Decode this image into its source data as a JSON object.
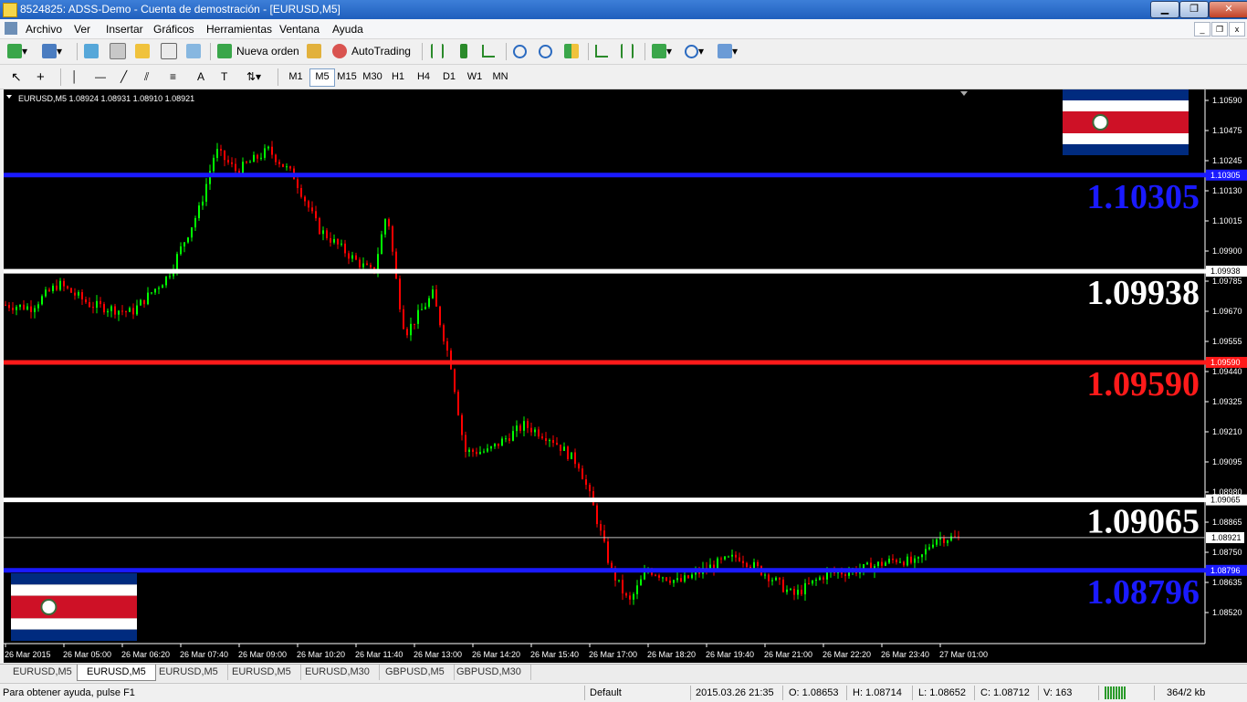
{
  "window": {
    "title": "8524825: ADSS-Demo - Cuenta de demostración - [EURUSD,M5]",
    "minimize": "▁",
    "restore": "❐",
    "close": "✕"
  },
  "menu": [
    "Archivo",
    "Ver",
    "Insertar",
    "Gráficos",
    "Herramientas",
    "Ventana",
    "Ayuda"
  ],
  "toolbar": {
    "new_order": "Nueva orden",
    "autotrading": "AutoTrading",
    "search_placeholder": ""
  },
  "timeframes": [
    "M1",
    "M5",
    "M15",
    "M30",
    "H1",
    "H4",
    "D1",
    "W1",
    "MN"
  ],
  "active_timeframe": "M5",
  "chart": {
    "header": "EURUSD,M5  1.08924 1.08931 1.08910 1.08921",
    "price_labels": [
      "1.10590",
      "1.10475",
      "1.10245",
      "1.10130",
      "1.10015",
      "1.09900",
      "1.09785",
      "1.09670",
      "1.09555",
      "1.09440",
      "1.09325",
      "1.09210",
      "1.09095",
      "1.08980",
      "1.08865",
      "1.08750",
      "1.08635",
      "1.08520"
    ],
    "time_labels": [
      "26 Mar 2015",
      "26 Mar 05:00",
      "26 Mar 06:20",
      "26 Mar 07:40",
      "26 Mar 09:00",
      "26 Mar 10:20",
      "26 Mar 11:40",
      "26 Mar 13:00",
      "26 Mar 14:20",
      "26 Mar 15:40",
      "26 Mar 17:00",
      "26 Mar 18:20",
      "26 Mar 19:40",
      "26 Mar 21:00",
      "26 Mar 22:20",
      "26 Mar 23:40",
      "27 Mar 01:00"
    ],
    "levels": [
      {
        "price": 1.10305,
        "label": "1.10305",
        "color": "#1a1aff",
        "axis_label": "1.10305"
      },
      {
        "price": 1.09938,
        "label": "1.09938",
        "color": "#ffffff",
        "axis_label": "1.09938"
      },
      {
        "price": 1.0959,
        "label": "1.09590",
        "color": "#ff1a1a",
        "axis_label": "1.09590"
      },
      {
        "price": 1.09065,
        "label": "1.09065",
        "color": "#ffffff",
        "axis_label": "1.09065"
      },
      {
        "price": 1.08796,
        "label": "1.08796",
        "color": "#1a1aff",
        "axis_label": "1.08796"
      }
    ],
    "current_price": "1.08921",
    "colors": {
      "bull": "#00ff00",
      "bear": "#ff0000",
      "background": "#000000",
      "text": "#ffffff"
    },
    "flag_colors": [
      "#002b7f",
      "#ffffff",
      "#ce1126"
    ]
  },
  "tabs": [
    "EURUSD,M5",
    "EURUSD,M5",
    "EURUSD,M5",
    "EURUSD,M5",
    "EURUSD,M30",
    "GBPUSD,M5",
    "GBPUSD,M30"
  ],
  "active_tab": 1,
  "status": {
    "help": "Para obtener ayuda, pulse F1",
    "profile": "Default",
    "datetime": "2015.03.26 21:35",
    "open": "O: 1.08653",
    "high": "H: 1.08714",
    "low": "L: 1.08652",
    "close": "C: 1.08712",
    "volume": "V: 163",
    "traffic": "364/2 kb"
  }
}
